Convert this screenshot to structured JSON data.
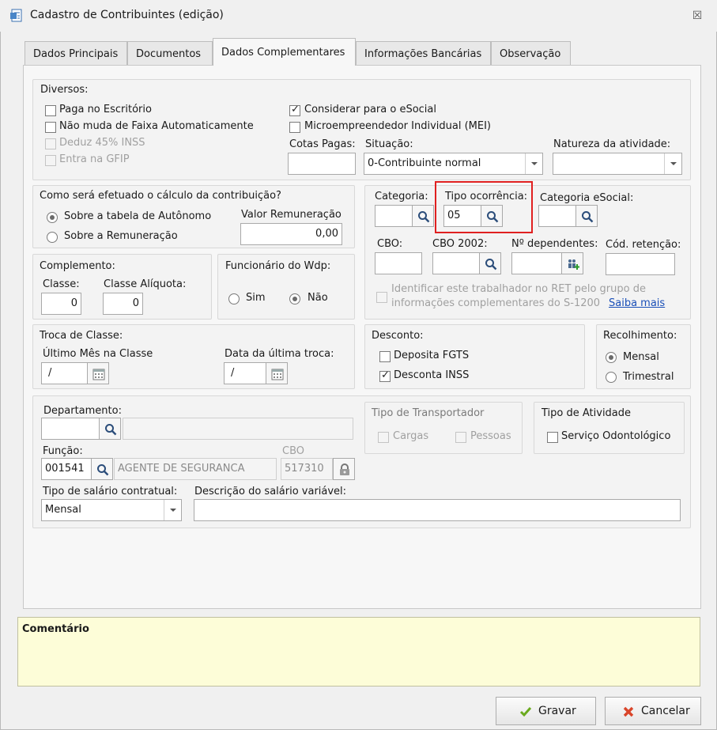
{
  "window": {
    "title": "Cadastro de Contribuintes (edição)",
    "close_glyph": "☒"
  },
  "tabs": [
    {
      "label": "Dados Principais"
    },
    {
      "label": "Documentos"
    },
    {
      "label": "Dados Complementares"
    },
    {
      "label": "Informações Bancárias"
    },
    {
      "label": "Observação"
    }
  ],
  "diversos": {
    "title": "Diversos:",
    "paga_escritorio": "Paga no Escritório",
    "nao_muda_faixa": "Não muda de Faixa Automaticamente",
    "deduz_inss": "Deduz 45% INSS",
    "entra_gfip": "Entra na GFIP",
    "considerar_esocial": "Considerar para o eSocial",
    "mei": "Microempreendedor Individual (MEI)",
    "cotas_pagas_label": "Cotas Pagas:",
    "cotas_pagas_value": "",
    "situacao_label": "Situação:",
    "situacao_value": "0-Contribuinte normal",
    "natureza_label": "Natureza da atividade:",
    "natureza_value": "",
    "check_glyph": "✓"
  },
  "calculo": {
    "title": "Como será efetuado o cálculo da contribuição?",
    "opt_autonomo": "Sobre a tabela de Autônomo",
    "opt_remuneracao": "Sobre a Remuneração",
    "valor_label": "Valor Remuneração",
    "valor_value": "0,00"
  },
  "categoria": {
    "categoria_label": "Categoria:",
    "categoria_value": "",
    "tipo_ocorrencia_label": "Tipo ocorrência:",
    "tipo_ocorrencia_value": "05",
    "categoria_esocial_label": "Categoria eSocial:",
    "categoria_esocial_value": "",
    "cbo_label": "CBO:",
    "cbo_value": "",
    "cbo2002_label": "CBO 2002:",
    "cbo2002_value": "",
    "dependentes_label": "Nº dependentes:",
    "dependentes_value": "",
    "retencao_label": "Cód. retenção:",
    "retencao_value": "",
    "ret_line1": "Identificar este trabalhador no RET pelo grupo de",
    "ret_line2": "informações complementares do S-1200",
    "saiba_mais": "Saiba mais"
  },
  "complemento": {
    "title": "Complemento:",
    "classe_label": "Classe:",
    "classe_value": "0",
    "aliquota_label": "Classe Alíquota:",
    "aliquota_value": "0"
  },
  "wdp": {
    "title": "Funcionário do Wdp:",
    "sim": "Sim",
    "nao": "Não"
  },
  "troca": {
    "title": "Troca de Classe:",
    "ultimo_label": "Último Mês na Classe",
    "ultimo_value": "/",
    "data_label": "Data da última troca:",
    "data_value": "/"
  },
  "desconto": {
    "title": "Desconto:",
    "fgts": "Deposita FGTS",
    "inss": "Desconta INSS"
  },
  "recolhimento": {
    "title": "Recolhimento:",
    "mensal": "Mensal",
    "trimestral": "Trimestral"
  },
  "departamento": {
    "label": "Departamento:",
    "code": "",
    "name": "",
    "funcao_label": "Função:",
    "funcao_code": "001541",
    "funcao_name": "AGENTE DE SEGURANCA",
    "cbo_label": "CBO",
    "cbo_value": "517310",
    "salario_label": "Tipo de salário contratual:",
    "salario_value": "Mensal",
    "descricao_label": "Descrição do salário variável:",
    "descricao_value": ""
  },
  "transportador": {
    "title": "Tipo de Transportador",
    "cargas": "Cargas",
    "pessoas": "Pessoas"
  },
  "atividade": {
    "title": "Tipo de Atividade",
    "odontologico": "Serviço Odontológico"
  },
  "comentario": {
    "label": "Comentário",
    "value": ""
  },
  "buttons": {
    "gravar": "Gravar",
    "cancelar": "Cancelar"
  },
  "colors": {
    "highlight": "#e02020",
    "comment_bg": "#fdfdd8",
    "link": "#1a4fb8"
  }
}
